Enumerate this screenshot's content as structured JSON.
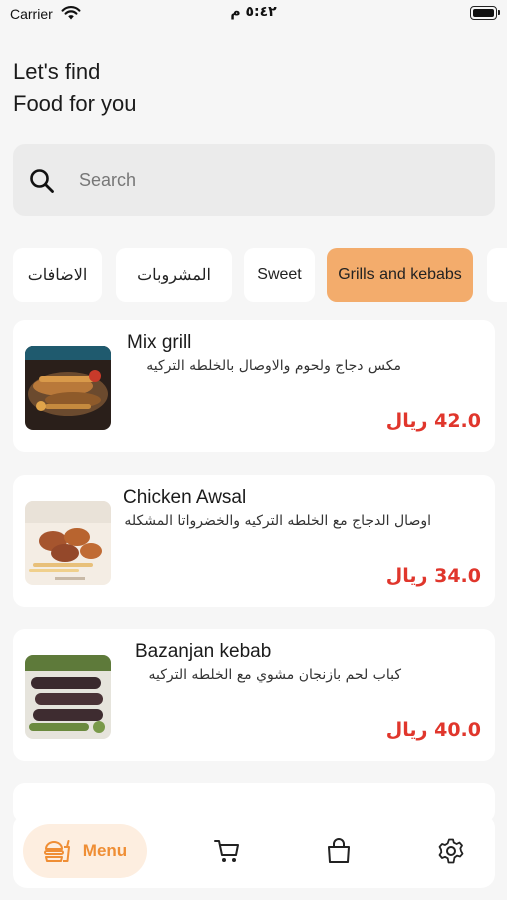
{
  "status_bar": {
    "carrier": "Carrier",
    "time": "٥:٤٢ م"
  },
  "header": {
    "title_line1": "Let's find",
    "title_line2": "Food for you"
  },
  "search": {
    "placeholder": "Search",
    "icon": "search-icon"
  },
  "categories": [
    {
      "label": "الاضافات",
      "active": false
    },
    {
      "label": "المشروبات",
      "active": false
    },
    {
      "label": "Sweet",
      "active": false
    },
    {
      "label": "Grills and kebabs",
      "active": true
    }
  ],
  "items": [
    {
      "name": "Mix grill",
      "description": "مكس دجاج ولحوم والاوصال  بالخلطه التركيه",
      "price": "42.0 ريال"
    },
    {
      "name": "Chicken Awsal",
      "description": "اوصال الدجاج مع الخلطه التركيه والخضرواتا المشكله",
      "price": "34.0 ريال"
    },
    {
      "name": "Bazanjan kebab",
      "description": "كباب لحم بازنجان مشوي مع الخلطه التركيه",
      "price": "40.0 ريال"
    }
  ],
  "bottom_nav": {
    "menu_label": "Menu",
    "items": [
      "burger-icon",
      "cart-icon",
      "bag-icon",
      "gear-icon"
    ]
  },
  "colors": {
    "accent": "#f3ac6c",
    "accent_text": "#ef8e35",
    "price": "#e0362c"
  }
}
